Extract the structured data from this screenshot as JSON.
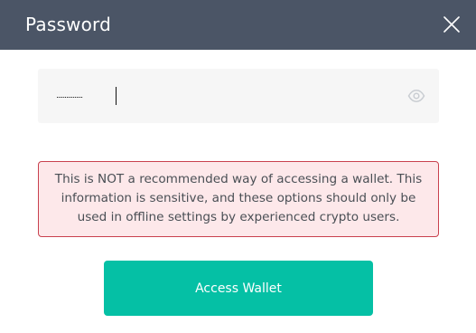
{
  "dialog": {
    "title": "Password"
  },
  "password": {
    "masked_value": "․․․․․․․․․․․․․․․․",
    "placeholder": ""
  },
  "icons": {
    "close": "close-icon",
    "visibility": "eye-icon"
  },
  "warning": {
    "text": "This is NOT a recommended way of accessing a wallet. This information is sensitive, and these options should only be used in offline settings by experienced crypto users."
  },
  "actions": {
    "access_label": "Access Wallet"
  },
  "colors": {
    "header_bg": "#4b5566",
    "input_bg": "#f6f6f6",
    "warning_bg": "#fde8ea",
    "warning_border": "#c9414e",
    "accent": "#05c0a5"
  }
}
